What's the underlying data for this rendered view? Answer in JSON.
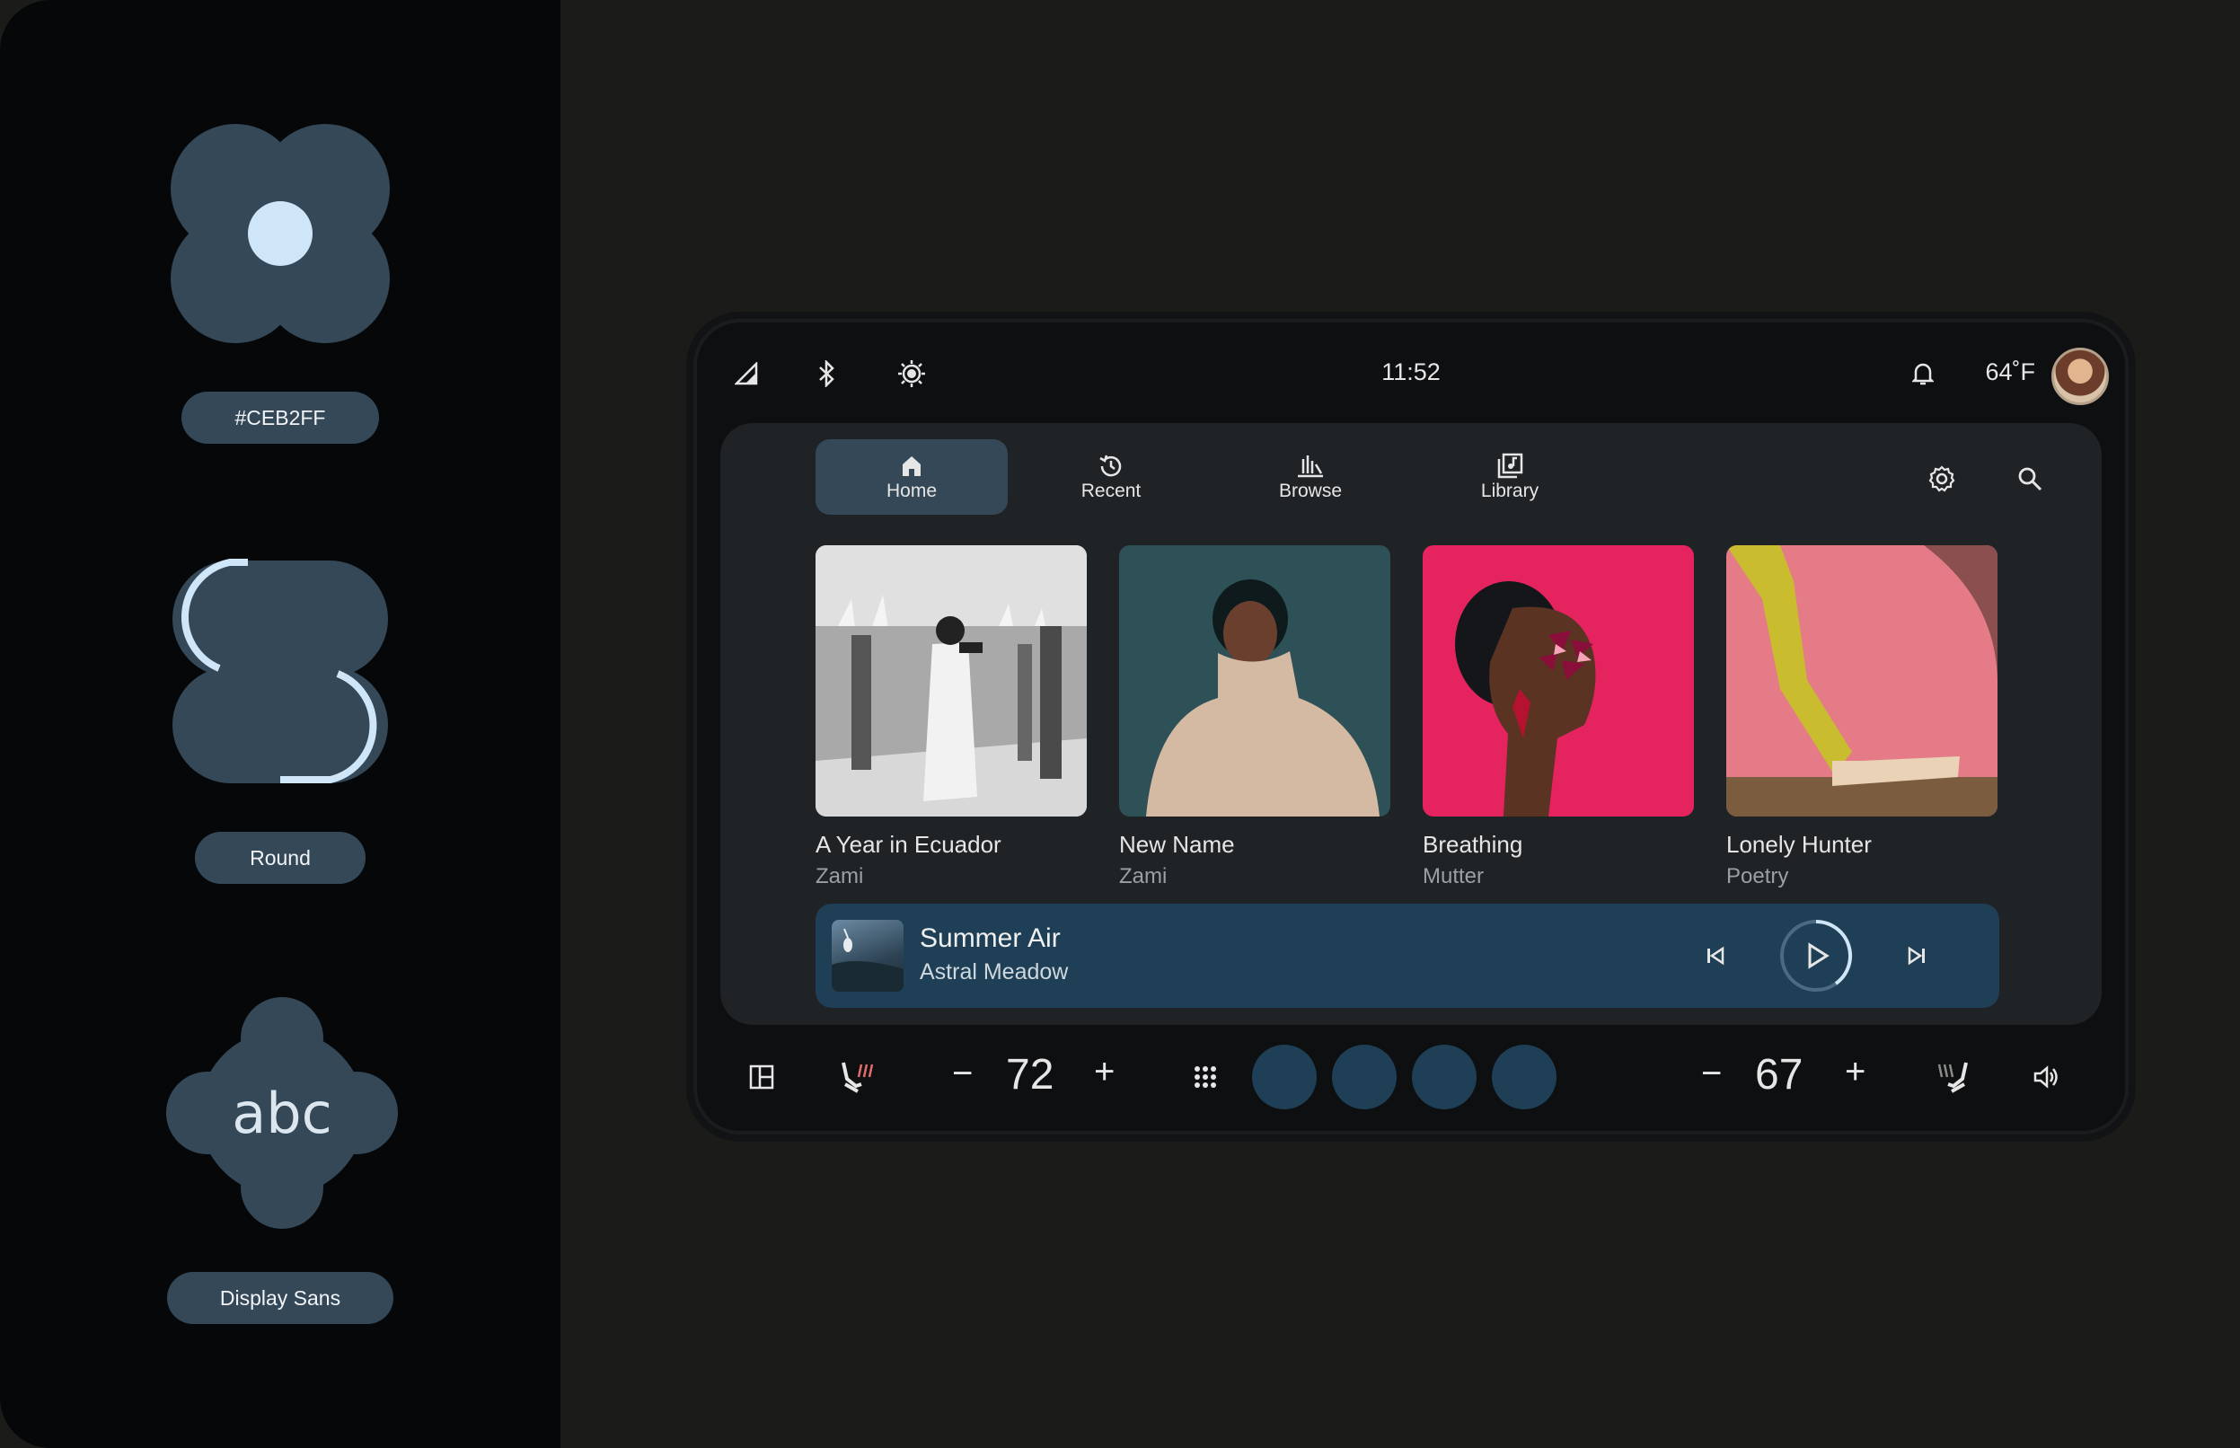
{
  "theme": {
    "seed_color_label": "#CEB2FF",
    "shape_label": "Round",
    "font_label": "Display Sans",
    "font_sample": "abc",
    "colors": {
      "container": "#344857",
      "accent_light": "#cfe5f8",
      "player_bg": "#1e3f56"
    }
  },
  "status_bar": {
    "icons": [
      "signal-icon",
      "bluetooth-icon",
      "brightness-icon"
    ],
    "time": "11:52",
    "temperature": "64˚F",
    "right_icons": [
      "bell-icon",
      "avatar"
    ]
  },
  "nav": {
    "tabs": [
      {
        "label": "Home",
        "icon": "home-icon",
        "active": true
      },
      {
        "label": "Recent",
        "icon": "history-icon",
        "active": false
      },
      {
        "label": "Browse",
        "icon": "browse-icon",
        "active": false
      },
      {
        "label": "Library",
        "icon": "library-icon",
        "active": false
      }
    ],
    "actions": [
      "settings-icon",
      "search-icon"
    ]
  },
  "albums": [
    {
      "title": "A Year in Ecuador",
      "artist": "Zami"
    },
    {
      "title": "New Name",
      "artist": "Zami"
    },
    {
      "title": "Breathing",
      "artist": "Mutter"
    },
    {
      "title": "Lonely Hunter",
      "artist": "Poetry"
    }
  ],
  "now_playing": {
    "title": "Summer Air",
    "artist": "Astral Meadow",
    "controls": [
      "skip-previous-icon",
      "play-icon",
      "skip-next-icon"
    ]
  },
  "climate": {
    "left_temp": "72",
    "right_temp": "67",
    "minus": "−",
    "plus": "+",
    "shortcut_count": 4
  }
}
